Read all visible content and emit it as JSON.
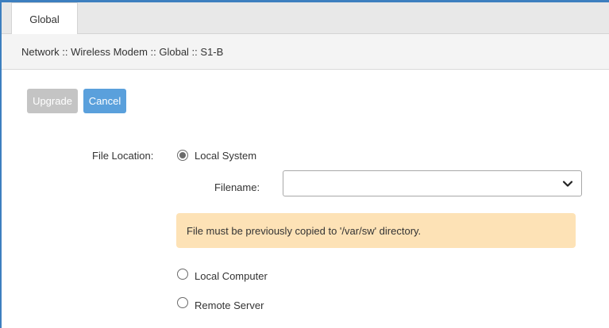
{
  "tabs": [
    {
      "label": "Global",
      "active": true
    }
  ],
  "breadcrumb": "Network :: Wireless Modem :: Global :: S1-B",
  "toolbar": {
    "upgrade_label": "Upgrade",
    "cancel_label": "Cancel"
  },
  "form": {
    "file_location_label": "File Location:",
    "options": [
      {
        "label": "Local System",
        "selected": true
      },
      {
        "label": "Local Computer",
        "selected": false
      },
      {
        "label": "Remote Server",
        "selected": false
      }
    ],
    "filename_label": "Filename:",
    "filename_value": ""
  },
  "alert_text": "File must be previously copied to '/var/sw' directory.",
  "colors": {
    "accent": "#3d7fbf",
    "button_primary": "#5aa0dc",
    "button_disabled": "#c4c4c4",
    "alert_bg": "#fde2b6"
  }
}
